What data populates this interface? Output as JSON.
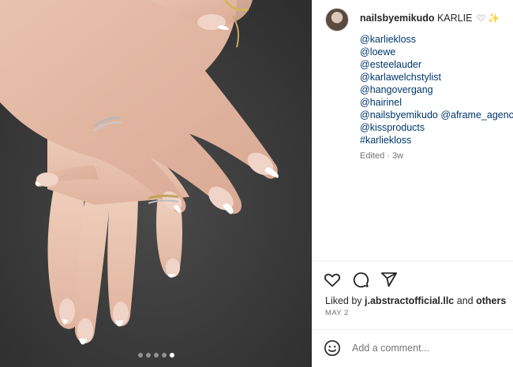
{
  "post": {
    "dots": [
      false,
      false,
      false,
      false,
      true
    ]
  },
  "caption": {
    "username": "nailsbyemikudo",
    "text": "KARLIE",
    "heart_emoji": "white-heart",
    "sparkle_emoji": "✨",
    "tags": [
      "@karliekloss",
      "@loewe",
      "@esteelauder",
      "@karlawelchstylist",
      "@hangovergang",
      "@hairinel",
      "@nailsbyemikudo @aframe_agency",
      "@kissproducts",
      "#karliekloss"
    ],
    "edited": "Edited · 3w"
  },
  "actions": {
    "icons": [
      "heart-icon",
      "comment-icon",
      "share-icon"
    ]
  },
  "likes": {
    "prefix": "Liked by ",
    "user": "j.abstractofficial.llc",
    "middle": " and ",
    "others": "others"
  },
  "date": "MAY 2",
  "comment": {
    "placeholder": "Add a comment..."
  },
  "colors": {
    "link": "#00376b",
    "text": "#262626",
    "muted": "#737373",
    "background_media": "#3a3a3a"
  }
}
